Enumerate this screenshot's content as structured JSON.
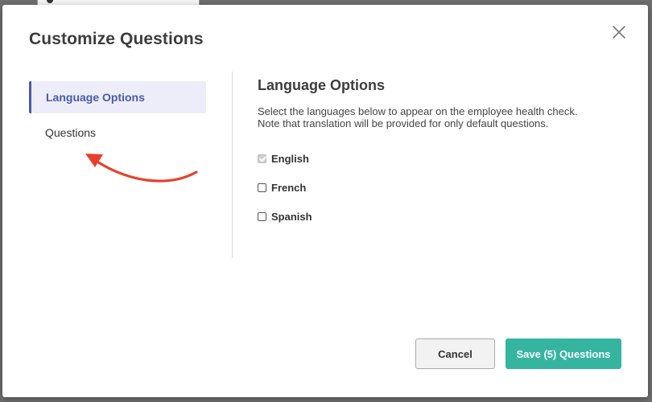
{
  "modal": {
    "title": "Customize Questions",
    "close_icon": "close-x-icon"
  },
  "sidebar": {
    "items": [
      {
        "label": "Language Options",
        "active": true
      },
      {
        "label": "Questions",
        "active": false
      }
    ]
  },
  "content": {
    "title": "Language Options",
    "description_line1": "Select the languages below to appear on the employee health check.",
    "description_line2": "Note that translation will be provided for only default questions.",
    "languages": [
      {
        "label": "English",
        "checked": true,
        "disabled": true
      },
      {
        "label": "French",
        "checked": false,
        "disabled": false
      },
      {
        "label": "Spanish",
        "checked": false,
        "disabled": false
      }
    ]
  },
  "footer": {
    "cancel_label": "Cancel",
    "save_label": "Save (5) Questions"
  },
  "colors": {
    "accent": "#4a5aa8",
    "active_bg": "#ecedf8",
    "primary_button": "#35b5a0",
    "annotation_arrow": "#e8402a"
  }
}
